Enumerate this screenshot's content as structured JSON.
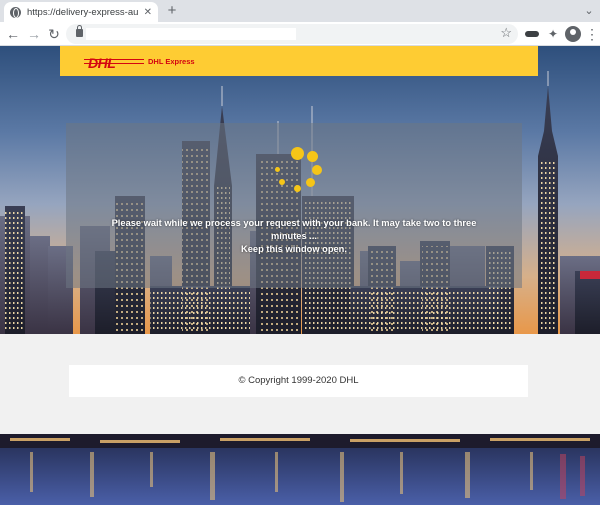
{
  "browser": {
    "tab_title": "https://delivery-express-au",
    "tab_close": "✕",
    "new_tab": "+",
    "back_icon": "←",
    "forward_icon": "→",
    "reload_icon": "↻",
    "star_icon": "☆",
    "extension_icon": "✦",
    "menu_icon": "⋮",
    "window_control": "⌄"
  },
  "header": {
    "logo_text": "DHL",
    "brand_text": "DHL Express",
    "background_color": "#fecc33",
    "logo_color": "#d40511"
  },
  "processing": {
    "message_line1": "Please wait while we process your request with your bank. It may take two to three minutes ...",
    "message_line2": "Keep this window open.",
    "spinner_color": "#f5c518"
  },
  "footer": {
    "copyright": "© Copyright 1999-2020 DHL"
  }
}
